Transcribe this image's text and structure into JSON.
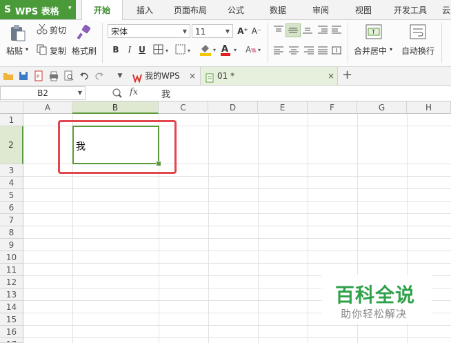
{
  "app": {
    "logo_glyph": "S",
    "name": "WPS 表格",
    "dropdown": "▾"
  },
  "menu": {
    "tabs": [
      "开始",
      "插入",
      "页面布局",
      "公式",
      "数据",
      "审阅",
      "视图",
      "开发工具",
      "云"
    ],
    "active_index": 0
  },
  "ribbon": {
    "paste": "粘贴",
    "cut": "剪切",
    "copy": "复制",
    "format_painter": "格式刷",
    "font_name": "宋体",
    "font_size": "11",
    "bold": "B",
    "italic": "I",
    "underline": "U",
    "grow_font": "A⁺",
    "shrink_font": "A⁻",
    "merge_center": "合并居中",
    "wrap_text": "自动换行"
  },
  "doc_tabs": {
    "home_tab": "我的WPS",
    "active_tab": "01 *",
    "close_glyph": "×",
    "new_tab_glyph": "+"
  },
  "formula_bar": {
    "cell_ref": "B2",
    "fx_label": "fx",
    "content": "我"
  },
  "sheet": {
    "columns": [
      "A",
      "B",
      "C",
      "D",
      "E",
      "F",
      "G",
      "H"
    ],
    "selected_column": "B",
    "rows": [
      "1",
      "2",
      "3",
      "4",
      "5",
      "6",
      "7",
      "8",
      "9",
      "10",
      "11",
      "12",
      "13",
      "14",
      "15",
      "16",
      "17"
    ],
    "selected_row": "2",
    "active_cell_value": "我"
  },
  "watermark": {
    "title": "百科全说",
    "subtitle": "助你轻松解决"
  },
  "colors": {
    "brand_green": "#4a9a3a",
    "selection_green": "#5a9a3a",
    "highlight_red": "#e0464c",
    "watermark_green": "#2fa14a"
  }
}
